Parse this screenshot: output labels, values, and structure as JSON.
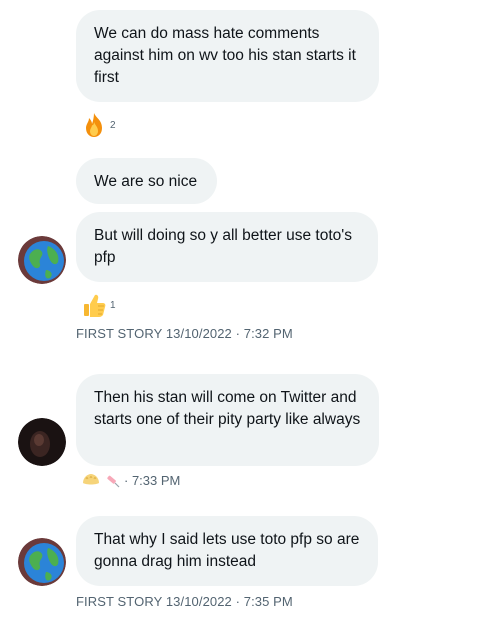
{
  "messages": [
    {
      "text": "We can do mass hate comments against him on wv too his stan starts it first",
      "reaction": {
        "icon": "fire-emoji",
        "count": "2"
      }
    },
    {
      "text": "We are so nice"
    },
    {
      "text": "But will doing so y all better use toto's pfp",
      "avatar": "globe-avatar",
      "reaction": {
        "icon": "thumbs-up-emoji",
        "count": "1"
      }
    },
    {
      "meta": "FIRST STORY 13/10/2022 · 7:32 PM"
    },
    {
      "text": "Then his stan will come on Twitter and starts one of their pity party like always",
      "avatar": "dark-avatar",
      "reaction": {
        "icons": [
          "dumpling-emoji",
          "syringe-emoji"
        ],
        "time": "· 7:33 PM"
      }
    },
    {
      "text": "That why I said lets use toto pfp so are gonna drag him instead",
      "avatar": "globe-avatar"
    },
    {
      "meta": "FIRST STORY 13/10/2022 · 7:35 PM"
    }
  ],
  "colors": {
    "bubble": "#eff3f4",
    "meta": "#536471",
    "text": "#0f1419"
  }
}
